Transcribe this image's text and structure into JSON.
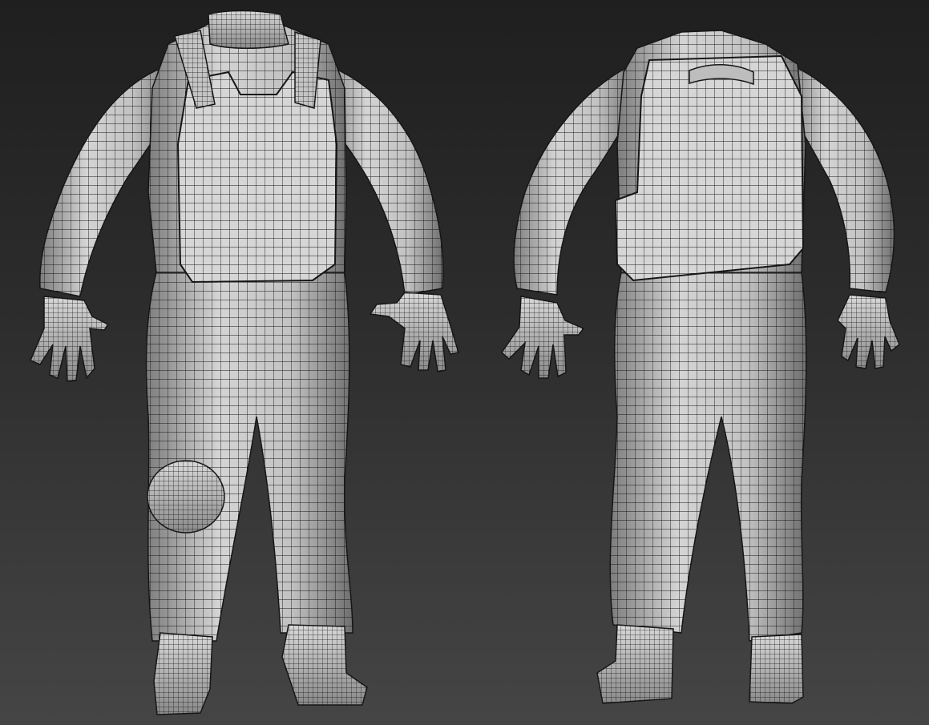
{
  "scene": {
    "background_top": "#1f1f1f",
    "background_bottom": "#454545",
    "mesh_fill": "#cfcfcf",
    "mesh_shade": "#8e8e8e",
    "wire_color": "#161616"
  },
  "models": [
    {
      "view": "front",
      "icon": "wireframe-soldier-front"
    },
    {
      "view": "back",
      "icon": "wireframe-soldier-back"
    }
  ]
}
